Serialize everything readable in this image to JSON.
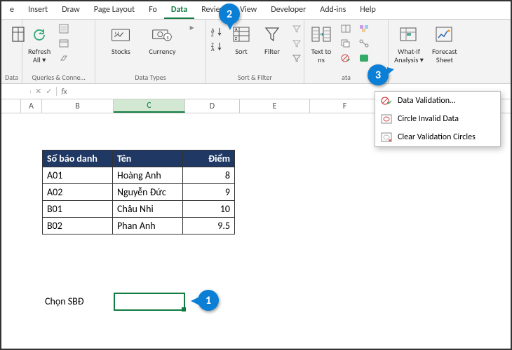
{
  "tabs": [
    "e",
    "Insert",
    "Draw",
    "Page Layout",
    "Fo",
    "Data",
    "Review",
    "View",
    "Developer",
    "Add-ins",
    "Help"
  ],
  "activeTab": "Data",
  "ribbon": {
    "refresh": "Refresh\nAll ▾",
    "g1": "Queries & Conne…",
    "g1_short": "Data",
    "stocks": "Stocks",
    "currency": "Currency",
    "g2": "Data Types",
    "sort": "Sort",
    "filter": "Filter",
    "g3": "Sort & Filter",
    "text_to": "Text to\n",
    "ns": "ns",
    "g4": "ata",
    "whatif": "What-If\nAnalysis ▾",
    "forecast": "Forecast\nSheet"
  },
  "fx": {
    "label": "fx"
  },
  "cols": [
    "A",
    "B",
    "C",
    "D",
    "E",
    "F"
  ],
  "table": {
    "headers": [
      "Số báo danh",
      "Tên",
      "Điểm"
    ],
    "rows": [
      [
        "A01",
        "Hoàng Anh",
        "8"
      ],
      [
        "A02",
        "Nguyễn Đức",
        "9"
      ],
      [
        "B01",
        "Châu Nhi",
        "10"
      ],
      [
        "B02",
        "Phan Anh",
        "9.5"
      ]
    ]
  },
  "chon": "Chọn SBĐ",
  "dv": {
    "validation": "Data Validation…",
    "circle": "Circle Invalid Data",
    "clear": "Clear Validation Circles"
  },
  "bubbles": {
    "b1": "1",
    "b2": "2",
    "b3": "3"
  }
}
